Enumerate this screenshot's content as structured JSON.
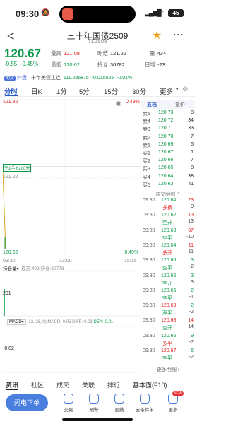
{
  "status": {
    "time": "09:30",
    "battery": "45"
  },
  "header": {
    "title": "三十年国债2509",
    "code": "TL2509"
  },
  "quote": {
    "price": "120.67",
    "change": "-0.55",
    "change_pct": "-0.45%",
    "high_label": "最高",
    "high": "121.08",
    "prev_label": "昨结",
    "prev": "121.22",
    "vol_label": "量",
    "vol": "434",
    "low_label": "最低",
    "low": "120.62",
    "oi_label": "持仓",
    "oi": "30782",
    "daily_label": "日增",
    "daily": "-23"
  },
  "ticker": {
    "tag": "期货",
    "tag2": "外盘",
    "name": "十年美债主连",
    "price": "111.296875",
    "change": "-0.015625",
    "pct": "-0.01%"
  },
  "tabs": [
    "分时",
    "日K",
    "1分",
    "5分",
    "15分",
    "30分",
    "更多"
  ],
  "chart": {
    "top_left": "121.82",
    "top_right": "0.49%",
    "mid_left": "121.22",
    "bottom_left": "120.62",
    "bottom_right": "-0.49%",
    "cursor_tag": "空1手 6200元",
    "t_start": "09:30",
    "t_mid": "13:00",
    "t_end": "15:15",
    "vol_label": "持仓量",
    "vol_info": "成交:402",
    "oi_info": "持仓:30778",
    "vol_axis": "201",
    "macd_label": "MACD",
    "macd_params": "(12, 26, 9)",
    "macd_val": "MACD:-0.05",
    "diff": "DIFF:-0.03",
    "dea": "DEA:-0.01",
    "macd_axis": "-0.02"
  },
  "orderbook": {
    "tab1": "五档",
    "tab2": "量价",
    "asks": [
      {
        "l": "卖5",
        "p": "120.73",
        "v": "8"
      },
      {
        "l": "卖4",
        "p": "120.72",
        "v": "34"
      },
      {
        "l": "卖3",
        "p": "120.71",
        "v": "33"
      },
      {
        "l": "卖2",
        "p": "120.70",
        "v": "7"
      },
      {
        "l": "卖1",
        "p": "120.69",
        "v": "5"
      }
    ],
    "bids": [
      {
        "l": "买1",
        "p": "120.67",
        "v": "1"
      },
      {
        "l": "买2",
        "p": "120.66",
        "v": "7"
      },
      {
        "l": "买3",
        "p": "120.65",
        "v": "8"
      },
      {
        "l": "买4",
        "p": "120.64",
        "v": "38"
      },
      {
        "l": "买5",
        "p": "120.63",
        "v": "41"
      }
    ],
    "detail_label": "成交明细"
  },
  "trades": [
    {
      "t": "09:30",
      "p": "120.64",
      "v": "23",
      "d": "多换",
      "c": "0"
    },
    {
      "t": "09:30",
      "p": "120.62",
      "v": "13",
      "d": "空开",
      "c": "13"
    },
    {
      "t": "09:30",
      "p": "120.63",
      "v": "37",
      "d": "空平",
      "c": "-10"
    },
    {
      "t": "09:30",
      "p": "120.64",
      "v": "11",
      "d": "多开",
      "c": "11"
    },
    {
      "t": "09:30",
      "p": "120.66",
      "v": "3",
      "d": "空平",
      "c": "-2"
    },
    {
      "t": "09:30",
      "p": "120.66",
      "v": "3",
      "d": "空开",
      "c": "3"
    },
    {
      "t": "09:30",
      "p": "120.66",
      "v": "2",
      "d": "空平",
      "c": "-1"
    },
    {
      "t": "09:30",
      "p": "120.68",
      "v": "2",
      "d": "双平",
      "c": "-2"
    },
    {
      "t": "09:30",
      "p": "120.68",
      "v": "14",
      "d": "空开",
      "c": "14"
    },
    {
      "t": "09:30",
      "p": "120.66",
      "v": "9",
      "d": "多平",
      "c": "-7"
    },
    {
      "t": "09:30",
      "p": "120.67",
      "v": "6",
      "d": "空平",
      "c": "-2"
    }
  ],
  "more_detail": "更多明细",
  "bottom_tabs": [
    "资讯",
    "社区",
    "成交",
    "关联",
    "排行",
    "基本面(F10)"
  ],
  "actions": {
    "flash": "闪电下单",
    "items": [
      "交易",
      "预警",
      "画线",
      "云条件单",
      "更多"
    ],
    "new_badge": "NEW"
  }
}
